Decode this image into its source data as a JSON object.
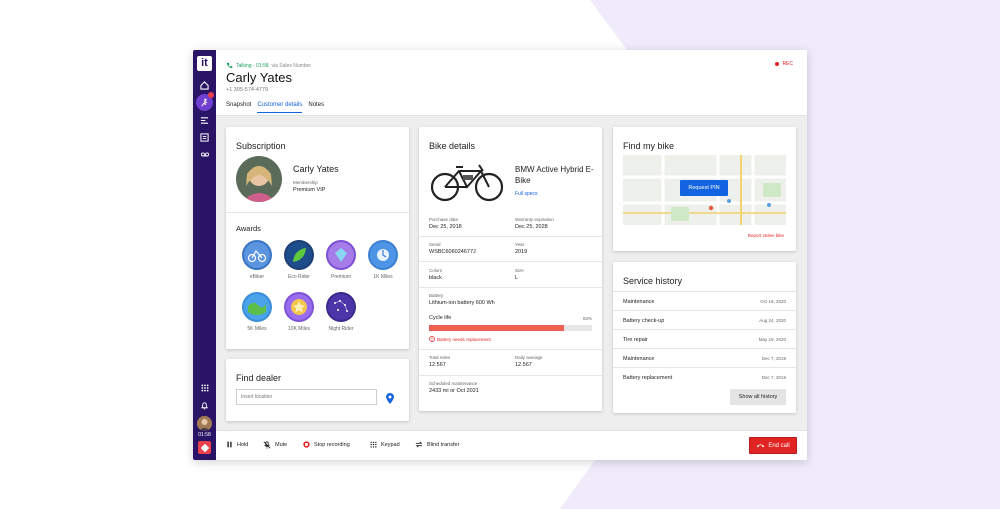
{
  "colors": {
    "rail": "#2a1466",
    "accent": "#1463e0",
    "danger": "#e02424",
    "success": "#1aa05a",
    "bg_shape": "#f0ebfb"
  },
  "header": {
    "status": "Talking · 01:58",
    "via": "via Sales Number",
    "rec": "REC",
    "customer_name": "Carly Yates",
    "customer_phone": "+1 305-574-4779",
    "tabs": [
      {
        "label": "Snapshot"
      },
      {
        "label": "Customer details"
      },
      {
        "label": "Notes"
      }
    ],
    "active_tab": "Customer details"
  },
  "rail": {
    "logo": "it",
    "timer": "01:58"
  },
  "subscription": {
    "title": "Subscription",
    "name": "Carly Yates",
    "membership_label": "Membership",
    "membership_value": "Premium VIP",
    "awards_title": "Awards",
    "awards": [
      {
        "label": "eBiker",
        "icon": "ebiker-badge-icon"
      },
      {
        "label": "Eco Rider",
        "icon": "eco-rider-badge-icon"
      },
      {
        "label": "Premium",
        "icon": "premium-badge-icon"
      },
      {
        "label": "1K Miles",
        "icon": "1k-miles-badge-icon"
      },
      {
        "label": "5K Miles",
        "icon": "5k-miles-badge-icon"
      },
      {
        "label": "10K Miles",
        "icon": "10k-miles-badge-icon"
      },
      {
        "label": "Night Rider",
        "icon": "night-rider-badge-icon"
      }
    ]
  },
  "dealer": {
    "title": "Find dealer",
    "placeholder": "Insert location"
  },
  "bike": {
    "title": "Bike details",
    "model": "BMW Active Hybrid E-Bike",
    "full_specs": "Full specs",
    "purchase_label": "Purchase date",
    "purchase_value": "Dec 25, 2018",
    "warranty_label": "Warranty expiration",
    "warranty_value": "Dec 25, 2028",
    "serial_label": "Serial",
    "serial_value": "WSBC606024677J",
    "year_label": "Year",
    "year_value": "2019",
    "colors_label": "Colors",
    "colors_value": "black",
    "size_label": "Size",
    "size_value": "L",
    "battery_label": "Battery",
    "battery_value": "Lithium-ion battery 600 Wh",
    "cycle_label": "Cycle life",
    "cycle_percent": "83%",
    "cycle_fraction": 0.83,
    "battery_warning": "Battery needs replacement",
    "miles_label": "Total miles",
    "miles_value": "12.567",
    "avg_label": "Daily average",
    "avg_value": "12.567",
    "maint_label": "Scheduled maintenance",
    "maint_value": "2433 mi or Oct 2021"
  },
  "findbike": {
    "title": "Find my bike",
    "request_pin": "Request PIN",
    "report_stolen": "Report stolen bike"
  },
  "service": {
    "title": "Service history",
    "rows": [
      {
        "name": "Maintenance",
        "date": "Oct 16, 2020"
      },
      {
        "name": "Battery check-up",
        "date": "Aug 24, 2020"
      },
      {
        "name": "Tire repair",
        "date": "May 19, 2020"
      },
      {
        "name": "Maintenance",
        "date": "Dec 7, 2019"
      },
      {
        "name": "Battery replacement",
        "date": "Dec 7, 2019"
      }
    ],
    "show_all": "Show all history"
  },
  "footer": {
    "hold": "Hold",
    "mute": "Mute",
    "stop_recording": "Stop recording",
    "keypad": "Keypad",
    "blind_transfer": "Blind transfer",
    "end_call": "End call"
  }
}
